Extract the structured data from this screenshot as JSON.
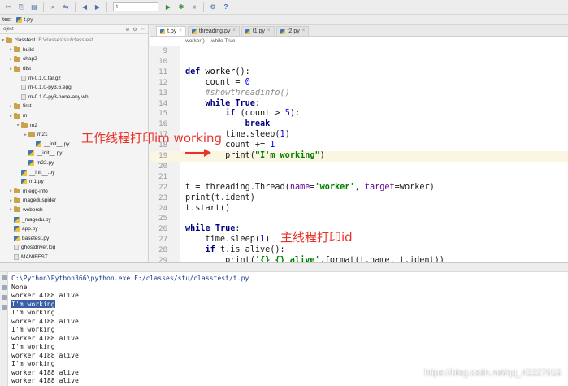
{
  "toolbar": {
    "icons": [
      "cut-icon",
      "copy-icon",
      "paste-icon",
      "find-icon",
      "replace-icon",
      "back-icon",
      "forward-icon"
    ],
    "run_config": "t",
    "help": "?"
  },
  "breadcrumbs": [
    "test",
    "t.py"
  ],
  "project": {
    "header_left": "oject",
    "root_name": "classtest",
    "root_path": "F:\\classes\\stu\\classtest",
    "items": [
      {
        "label": "build",
        "type": "folder",
        "depth": 0
      },
      {
        "label": "chap2",
        "type": "folder",
        "depth": 0
      },
      {
        "label": "dist",
        "type": "folder",
        "depth": 0
      },
      {
        "label": "m-0.1.0.tar.gz",
        "type": "file",
        "depth": 1
      },
      {
        "label": "m-0.1.0-py3.6.egg",
        "type": "file",
        "depth": 1
      },
      {
        "label": "m-0.1.0-py3-none-any.whl",
        "type": "file",
        "depth": 1
      },
      {
        "label": "first",
        "type": "folder",
        "depth": 0
      },
      {
        "label": "m",
        "type": "folder",
        "depth": 0
      },
      {
        "label": "m2",
        "type": "folder",
        "depth": 1
      },
      {
        "label": "m21",
        "type": "folder",
        "depth": 2
      },
      {
        "label": "__init__.py",
        "type": "py",
        "depth": 3
      },
      {
        "label": "__init__.py",
        "type": "py",
        "depth": 2
      },
      {
        "label": "m22.py",
        "type": "py",
        "depth": 2
      },
      {
        "label": "__init__.py",
        "type": "py",
        "depth": 1
      },
      {
        "label": "m1.py",
        "type": "py",
        "depth": 1
      },
      {
        "label": "m.egg-info",
        "type": "folder",
        "depth": 0
      },
      {
        "label": "mageduspider",
        "type": "folder",
        "depth": 0
      },
      {
        "label": "weberch",
        "type": "folder",
        "depth": 0
      },
      {
        "label": "_magedu.py",
        "type": "py",
        "depth": 0
      },
      {
        "label": "app.py",
        "type": "py",
        "depth": 0
      },
      {
        "label": "basetest.py",
        "type": "py",
        "depth": 0
      },
      {
        "label": "ghostdriver.log",
        "type": "file",
        "depth": 0
      },
      {
        "label": "MANIFEST",
        "type": "file",
        "depth": 0
      }
    ]
  },
  "editor": {
    "tabs": [
      {
        "label": "t.py",
        "active": true
      },
      {
        "label": "threading.py",
        "active": false
      },
      {
        "label": "t1.py",
        "active": false
      },
      {
        "label": "t2.py",
        "active": false
      }
    ],
    "crumbs": [
      "worker()",
      "while True"
    ],
    "line_numbers": [
      "9",
      "10",
      "11",
      "12",
      "13",
      "14",
      "15",
      "16",
      "17",
      "18",
      "19",
      "20",
      "21",
      "22",
      "23",
      "24",
      "25",
      "26",
      "27",
      "28",
      "29"
    ],
    "highlighted_line": "19"
  },
  "annotations": {
    "worker_note": "工作线程打印im working",
    "main_note": "主线程打印id"
  },
  "console": {
    "command": "C:\\Python\\Python366\\python.exe F:/classes/stu/classtest/t.py",
    "lines": [
      "None",
      "worker 4188 alive",
      "I'm working",
      "I'm working",
      "worker 4188 alive",
      "I'm working",
      "worker 4188 alive",
      "I'm working",
      "worker 4188 alive",
      "I'm working",
      "worker 4188 alive",
      "worker 4188 alive"
    ],
    "selected_line_index": 2
  },
  "watermark": "https://blog.csdn.net/qq_42227818"
}
